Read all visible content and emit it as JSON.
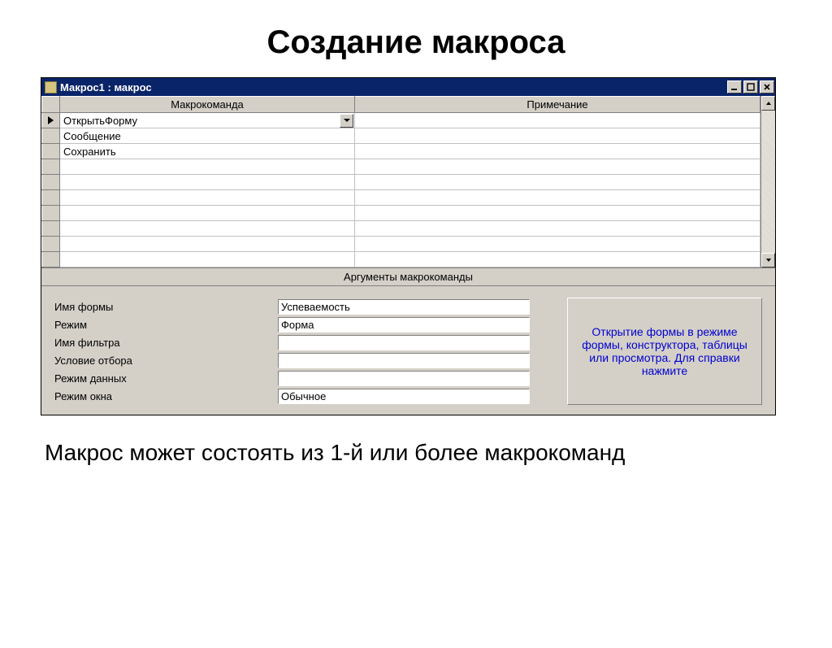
{
  "page_title": "Создание макроса",
  "window_title": "Макрос1 : макрос",
  "grid": {
    "headers": {
      "macro_command": "Макрокоманда",
      "note": "Примечание"
    },
    "rows": [
      {
        "command": "ОткрытьФорму",
        "note": "",
        "selected": true,
        "has_dropdown": true
      },
      {
        "command": "Сообщение",
        "note": ""
      },
      {
        "command": "Сохранить",
        "note": ""
      },
      {
        "command": "",
        "note": ""
      },
      {
        "command": "",
        "note": ""
      },
      {
        "command": "",
        "note": ""
      },
      {
        "command": "",
        "note": ""
      },
      {
        "command": "",
        "note": ""
      },
      {
        "command": "",
        "note": ""
      },
      {
        "command": "",
        "note": ""
      }
    ]
  },
  "arguments_pane": {
    "title": "Аргументы макрокоманды",
    "fields": [
      {
        "label": "Имя формы",
        "value": "Успеваемость"
      },
      {
        "label": "Режим",
        "value": "Форма"
      },
      {
        "label": "Имя фильтра",
        "value": ""
      },
      {
        "label": "Условие отбора",
        "value": ""
      },
      {
        "label": "Режим данных",
        "value": ""
      },
      {
        "label": "Режим окна",
        "value": "Обычное"
      }
    ],
    "help_text": "Открытие формы в режиме формы, конструктора, таблицы или просмотра. Для справки нажмите"
  },
  "caption": "Макрос может состоять из 1-й или более макрокоманд"
}
